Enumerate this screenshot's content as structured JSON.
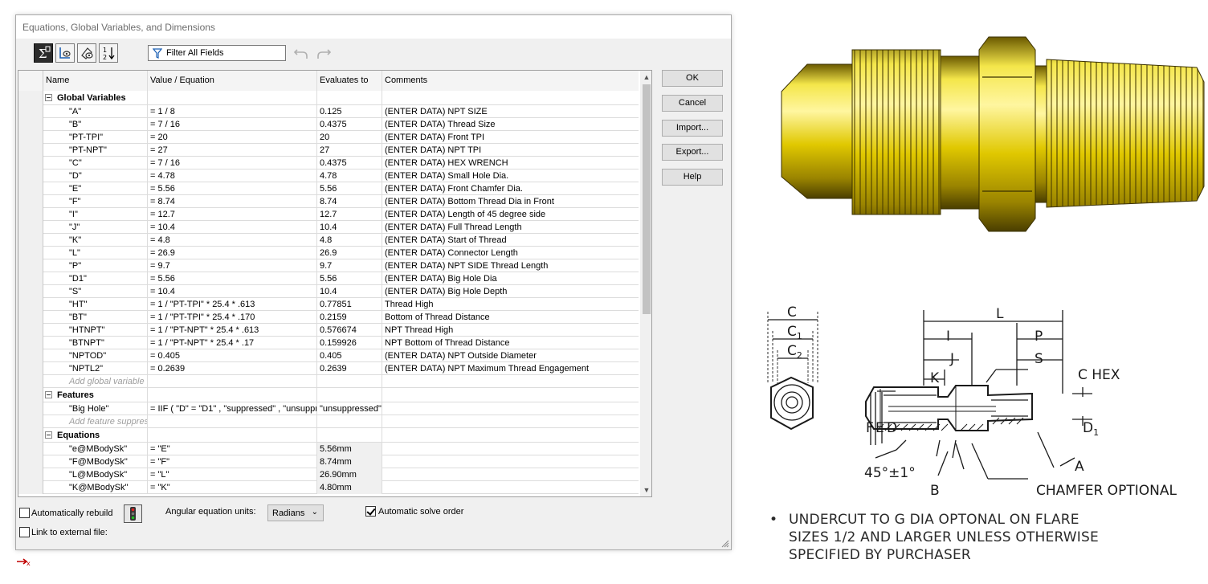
{
  "dialog": {
    "title": "Equations, Global Variables, and Dimensions",
    "filter_placeholder": "Filter All Fields",
    "icons": [
      "equation-view-icon",
      "sketch-equation-view-icon",
      "dimension-view-icon",
      "ordered-view-icon",
      "filter-icon",
      "undo-icon",
      "redo-icon"
    ]
  },
  "table": {
    "headers": {
      "name": "Name",
      "value": "Value / Equation",
      "evaluates": "Evaluates to",
      "comments": "Comments"
    },
    "sections": {
      "globals": "Global Variables",
      "features": "Features",
      "equations": "Equations"
    },
    "globals": [
      {
        "name": "\"A\"",
        "value": "= 1 / 8",
        "eval": "0.125",
        "comment": "(ENTER DATA) NPT SIZE"
      },
      {
        "name": "\"B\"",
        "value": "= 7 / 16",
        "eval": "0.4375",
        "comment": "(ENTER DATA) Thread Size"
      },
      {
        "name": "\"PT-TPI\"",
        "value": "= 20",
        "eval": "20",
        "comment": "(ENTER DATA) Front TPI"
      },
      {
        "name": "\"PT-NPT\"",
        "value": "= 27",
        "eval": "27",
        "comment": "(ENTER DATA) NPT TPI"
      },
      {
        "name": "\"C\"",
        "value": "= 7 / 16",
        "eval": "0.4375",
        "comment": "(ENTER DATA) HEX WRENCH"
      },
      {
        "name": "\"D\"",
        "value": "= 4.78",
        "eval": "4.78",
        "comment": "(ENTER DATA) Small Hole Dia."
      },
      {
        "name": "\"E\"",
        "value": "= 5.56",
        "eval": "5.56",
        "comment": "(ENTER DATA) Front Chamfer Dia."
      },
      {
        "name": "\"F\"",
        "value": "= 8.74",
        "eval": "8.74",
        "comment": "(ENTER DATA) Bottom Thread Dia in Front"
      },
      {
        "name": "\"I\"",
        "value": "= 12.7",
        "eval": "12.7",
        "comment": "(ENTER DATA) Length of 45 degree side"
      },
      {
        "name": "\"J\"",
        "value": "= 10.4",
        "eval": "10.4",
        "comment": "(ENTER DATA) Full  Thread Length"
      },
      {
        "name": "\"K\"",
        "value": "= 4.8",
        "eval": "4.8",
        "comment": "(ENTER DATA) Start of Thread"
      },
      {
        "name": "\"L\"",
        "value": "= 26.9",
        "eval": "26.9",
        "comment": "(ENTER DATA) Connector Length"
      },
      {
        "name": "\"P\"",
        "value": "= 9.7",
        "eval": "9.7",
        "comment": "(ENTER DATA) NPT SIDE  Thread Length"
      },
      {
        "name": "\"D1\"",
        "value": "= 5.56",
        "eval": "5.56",
        "comment": "(ENTER DATA) Big Hole Dia"
      },
      {
        "name": "\"S\"",
        "value": "= 10.4",
        "eval": "10.4",
        "comment": "(ENTER DATA) Big Hole Depth"
      },
      {
        "name": "\"HT\"",
        "value": "= 1 / \"PT-TPI\" * 25.4 * .613",
        "eval": "0.77851",
        "comment": "Thread High"
      },
      {
        "name": "\"BT\"",
        "value": "= 1 / \"PT-TPI\" * 25.4 * .170",
        "eval": "0.2159",
        "comment": "Bottom of Thread Distance"
      },
      {
        "name": "\"HTNPT\"",
        "value": "= 1 / \"PT-NPT\" * 25.4 * .613",
        "eval": "0.576674",
        "comment": "NPT Thread High"
      },
      {
        "name": "\"BTNPT\"",
        "value": "= 1 / \"PT-NPT\" * 25.4 * .17",
        "eval": "0.159926",
        "comment": "NPT Bottom of Thread Distance"
      },
      {
        "name": "\"NPTOD\"",
        "value": "= 0.405",
        "eval": "0.405",
        "comment": "(ENTER DATA) NPT Outside Diameter"
      },
      {
        "name": "\"NPTL2\"",
        "value": "= 0.2639",
        "eval": "0.2639",
        "comment": "(ENTER DATA) NPT Maximum Thread Engagement"
      }
    ],
    "add_global": "Add global variable",
    "features": [
      {
        "name": "\"Big Hole\"",
        "value": "= IIF ( \"D\" = \"D1\" , \"suppressed\" , \"unsuppressed\" )",
        "eval": "\"unsuppressed\"",
        "comment": ""
      }
    ],
    "add_feature": "Add feature suppress",
    "equations": [
      {
        "name": "\"e@MBodySk\"",
        "value": "= \"E\"",
        "eval": "5.56mm",
        "comment": ""
      },
      {
        "name": "\"F@MBodySk\"",
        "value": "= \"F\"",
        "eval": "8.74mm",
        "comment": ""
      },
      {
        "name": "\"L@MBodySk\"",
        "value": "= \"L\"",
        "eval": "26.90mm",
        "comment": ""
      },
      {
        "name": "\"K@MBodySk\"",
        "value": "= \"K\"",
        "eval": "4.80mm",
        "comment": ""
      }
    ]
  },
  "buttons": {
    "ok": "OK",
    "cancel": "Cancel",
    "import": "Import...",
    "export": "Export...",
    "help": "Help"
  },
  "options": {
    "auto_rebuild": "Automatically rebuild",
    "auto_rebuild_checked": false,
    "angular_units_label": "Angular equation units:",
    "angular_units_value": "Radians",
    "auto_solve": "Automatic solve order",
    "auto_solve_checked": true,
    "link_external": "Link to external file:",
    "link_external_checked": false
  },
  "drawing": {
    "labels": {
      "c": "C",
      "c1": "C",
      "c1_sub": "1",
      "c2": "C",
      "c2_sub": "2",
      "l": "L",
      "i": "I",
      "p": "P",
      "j": "J",
      "s": "S",
      "k": "K",
      "chex": "C HEX",
      "f": "F",
      "e": "E",
      "d": "D",
      "d1": "D",
      "d1_sub": "1",
      "angle": "45°±1°",
      "a": "A",
      "b": "B",
      "chamfer": "CHAMFER OPTIONAL"
    },
    "note_bullet": "•",
    "note_lines": [
      "UNDERCUT TO G DIA OPTONAL ON FLARE",
      "SIZES 1/2 AND LARGER UNLESS OTHERWISE",
      "SPECIFIED BY PURCHASER"
    ]
  },
  "colors": {
    "brass": "#e8d000",
    "brass_dark": "#6b5a00",
    "accent": "#2b2b2b"
  }
}
